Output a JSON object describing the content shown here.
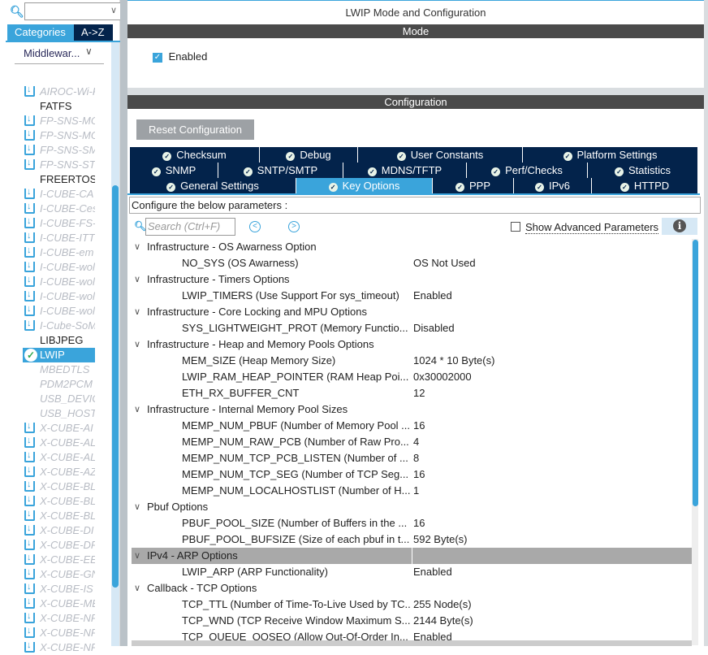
{
  "left": {
    "tabs": [
      "Categories",
      "A->Z"
    ],
    "category": "Middlewar...",
    "items": [
      {
        "label": "AIROC-Wi-F",
        "type": "download"
      },
      {
        "label": "FATFS",
        "type": "normal"
      },
      {
        "label": "FP-SNS-MO",
        "type": "download"
      },
      {
        "label": "FP-SNS-MO",
        "type": "download"
      },
      {
        "label": "FP-SNS-SM",
        "type": "download"
      },
      {
        "label": "FP-SNS-ST",
        "type": "download"
      },
      {
        "label": "FREERTOS",
        "type": "normal"
      },
      {
        "label": "I-CUBE-CA",
        "type": "download"
      },
      {
        "label": "I-CUBE-Ces",
        "type": "download"
      },
      {
        "label": "I-CUBE-FS-",
        "type": "download"
      },
      {
        "label": "I-CUBE-ITT",
        "type": "download"
      },
      {
        "label": "I-CUBE-em",
        "type": "download"
      },
      {
        "label": "I-CUBE-wol",
        "type": "download"
      },
      {
        "label": "I-CUBE-wol",
        "type": "download"
      },
      {
        "label": "I-CUBE-wol",
        "type": "download"
      },
      {
        "label": "I-CUBE-wol",
        "type": "download"
      },
      {
        "label": "I-Cube-SoM",
        "type": "download"
      },
      {
        "label": "LIBJPEG",
        "type": "normal"
      },
      {
        "label": "LWIP",
        "type": "selected"
      },
      {
        "label": "MBEDTLS",
        "type": "disabled"
      },
      {
        "label": "PDM2PCM",
        "type": "disabled"
      },
      {
        "label": "USB_DEVIC",
        "type": "disabled"
      },
      {
        "label": "USB_HOST",
        "type": "disabled"
      },
      {
        "label": "X-CUBE-AI",
        "type": "download"
      },
      {
        "label": "X-CUBE-AL",
        "type": "download"
      },
      {
        "label": "X-CUBE-AL",
        "type": "download"
      },
      {
        "label": "X-CUBE-AZ",
        "type": "download"
      },
      {
        "label": "X-CUBE-BL",
        "type": "download"
      },
      {
        "label": "X-CUBE-BL",
        "type": "download"
      },
      {
        "label": "X-CUBE-BL",
        "type": "download"
      },
      {
        "label": "X-CUBE-DI",
        "type": "download"
      },
      {
        "label": "X-CUBE-DP",
        "type": "download"
      },
      {
        "label": "X-CUBE-EE",
        "type": "download"
      },
      {
        "label": "X-CUBE-GN",
        "type": "download"
      },
      {
        "label": "X-CUBE-IS",
        "type": "download"
      },
      {
        "label": "X-CUBE-ME",
        "type": "download"
      },
      {
        "label": "X-CUBE-NF",
        "type": "download"
      },
      {
        "label": "X-CUBE-NF",
        "type": "download"
      },
      {
        "label": "X-CUBE-NF",
        "type": "download"
      }
    ]
  },
  "title": "LWIP Mode and Configuration",
  "mode": {
    "header": "Mode",
    "enabled_label": "Enabled",
    "enabled": true
  },
  "config": {
    "header": "Configuration",
    "reset_label": "Reset Configuration",
    "tab_rows": [
      [
        {
          "label": "Checksum",
          "w": 160
        },
        {
          "label": "Debug",
          "w": 121
        },
        {
          "label": "User Constants",
          "w": 203
        },
        {
          "label": "Platform Settings",
          "w": 216
        }
      ],
      [
        {
          "label": "SNMP",
          "w": 109
        },
        {
          "label": "SNTP/SMTP",
          "w": 154
        },
        {
          "label": "MDNS/TFTP",
          "w": 152
        },
        {
          "label": "Perf/Checks",
          "w": 149
        },
        {
          "label": "Statistics",
          "w": 136
        }
      ],
      [
        {
          "label": "General Settings",
          "w": 205
        },
        {
          "label": "Key Options",
          "w": 168,
          "active": true
        },
        {
          "label": "PPP",
          "w": 100
        },
        {
          "label": "IPv6",
          "w": 96
        },
        {
          "label": "HTTPD",
          "w": 131
        }
      ]
    ],
    "configure_text": "Configure the below parameters :",
    "search_placeholder": "Search (Ctrl+F)",
    "show_advanced_label": "Show Advanced Parameters",
    "show_advanced": false,
    "params": [
      {
        "group": "Infrastructure - OS Awarness Option"
      },
      {
        "name": "NO_SYS (OS Awarness)",
        "value": "OS Not Used"
      },
      {
        "group": "Infrastructure - Timers Options"
      },
      {
        "name": "LWIP_TIMERS (Use Support For sys_timeout)",
        "value": "Enabled"
      },
      {
        "group": "Infrastructure - Core Locking and MPU Options"
      },
      {
        "name": "SYS_LIGHTWEIGHT_PROT (Memory Functio...",
        "value": "Disabled"
      },
      {
        "group": "Infrastructure - Heap and Memory Pools Options"
      },
      {
        "name": "MEM_SIZE (Heap Memory Size)",
        "value": "1024 * 10 Byte(s)"
      },
      {
        "name": "LWIP_RAM_HEAP_POINTER (RAM Heap Poi...",
        "value": "0x30002000"
      },
      {
        "name": "ETH_RX_BUFFER_CNT",
        "value": "12"
      },
      {
        "group": "Infrastructure - Internal Memory Pool Sizes"
      },
      {
        "name": "MEMP_NUM_PBUF (Number of Memory Pool ...",
        "value": "16"
      },
      {
        "name": "MEMP_NUM_RAW_PCB (Number of Raw Pro...",
        "value": "4"
      },
      {
        "name": "MEMP_NUM_TCP_PCB_LISTEN (Number of ...",
        "value": "8"
      },
      {
        "name": "MEMP_NUM_TCP_SEG (Number of TCP Seg...",
        "value": "16"
      },
      {
        "name": "MEMP_NUM_LOCALHOSTLIST (Number of H...",
        "value": "1"
      },
      {
        "group": "Pbuf Options"
      },
      {
        "name": "PBUF_POOL_SIZE (Number of Buffers in the ...",
        "value": "16"
      },
      {
        "name": "PBUF_POOL_BUFSIZE (Size of each pbuf in t...",
        "value": "592 Byte(s)"
      },
      {
        "group": "IPv4 - ARP Options",
        "highlight": true
      },
      {
        "name": "LWIP_ARP (ARP Functionality)",
        "value": "Enabled"
      },
      {
        "group": "Callback - TCP Options"
      },
      {
        "name": "TCP_TTL (Number of Time-To-Live Used by TC...",
        "value": "255 Node(s)"
      },
      {
        "name": "TCP_WND (TCP Receive Window Maximum S...",
        "value": "2144 Byte(s)"
      },
      {
        "name": "TCP_QUEUE_OOSEQ (Allow Out-Of-Order In...",
        "value": "Enabled"
      }
    ]
  }
}
